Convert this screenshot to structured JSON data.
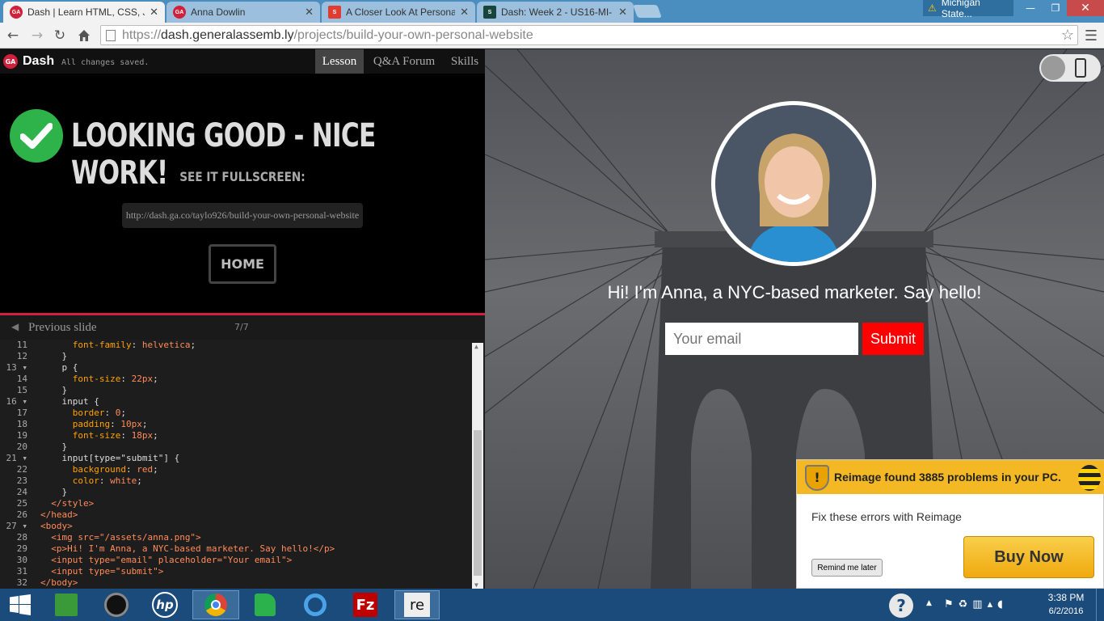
{
  "browser": {
    "tabs": [
      {
        "title": "Dash | Learn HTML, CSS, J",
        "fav_color": "#d0203b",
        "fav_text": "GA",
        "active": true
      },
      {
        "title": "Anna Dowlin",
        "fav_color": "#d0203b",
        "fav_text": "GA",
        "active": false
      },
      {
        "title": "A Closer Look At Personal",
        "fav_color": "#e03c31",
        "fav_text": "S",
        "active": false
      },
      {
        "title": "Dash: Week 2 - US16-MI-",
        "fav_color": "#18453b",
        "fav_text": "S",
        "active": false
      }
    ],
    "profile_label": "Michigan State...",
    "url_scheme": "https://",
    "url_host": "dash.generalassemb.ly",
    "url_path": "/projects/build-your-own-personal-website"
  },
  "app": {
    "brand": "Dash",
    "brand_badge": "GA",
    "status": "All changes saved.",
    "nav": [
      "Lesson",
      "Q&A Forum",
      "Skills"
    ],
    "headline": "LOOKING GOOD - NICE WORK!",
    "subhead": "SEE IT FULLSCREEN:",
    "fullscreen_url": "http://dash.ga.co/taylo926/build-your-own-personal-website",
    "home_label": "HOME",
    "prev_label": "Previous slide",
    "slide_counter": "7/7"
  },
  "editor": {
    "lines": [
      {
        "n": "11",
        "fold": false,
        "indent": "      ",
        "html": "font-family: helvetica;"
      },
      {
        "n": "12",
        "fold": false,
        "indent": "    ",
        "html": "}"
      },
      {
        "n": "13",
        "fold": true,
        "indent": "    ",
        "html": "p {"
      },
      {
        "n": "14",
        "fold": false,
        "indent": "      ",
        "html": "font-size: 22px;"
      },
      {
        "n": "15",
        "fold": false,
        "indent": "    ",
        "html": "}"
      },
      {
        "n": "16",
        "fold": true,
        "indent": "    ",
        "html": "input {"
      },
      {
        "n": "17",
        "fold": false,
        "indent": "      ",
        "html": "border: 0;"
      },
      {
        "n": "18",
        "fold": false,
        "indent": "      ",
        "html": "padding: 10px;"
      },
      {
        "n": "19",
        "fold": false,
        "indent": "      ",
        "html": "font-size: 18px;"
      },
      {
        "n": "20",
        "fold": false,
        "indent": "    ",
        "html": "}"
      },
      {
        "n": "21",
        "fold": true,
        "indent": "    ",
        "html": "input[type=\"submit\"] {"
      },
      {
        "n": "22",
        "fold": false,
        "indent": "      ",
        "html": "background: red;"
      },
      {
        "n": "23",
        "fold": false,
        "indent": "      ",
        "html": "color: white;"
      },
      {
        "n": "24",
        "fold": false,
        "indent": "    ",
        "html": "}"
      },
      {
        "n": "25",
        "fold": false,
        "indent": "  ",
        "html": "</style>"
      },
      {
        "n": "26",
        "fold": false,
        "indent": "",
        "html": "</head>"
      },
      {
        "n": "27",
        "fold": true,
        "indent": "",
        "html": "<body>"
      },
      {
        "n": "28",
        "fold": false,
        "indent": "  ",
        "html": "<img src=\"/assets/anna.png\">"
      },
      {
        "n": "29",
        "fold": false,
        "indent": "  ",
        "html": "<p>Hi! I'm Anna, a NYC-based marketer. Say hello!</p>"
      },
      {
        "n": "30",
        "fold": false,
        "indent": "  ",
        "html": "<input type=\"email\" placeholder=\"Your email\">"
      },
      {
        "n": "31",
        "fold": false,
        "indent": "  ",
        "html": "<input type=\"submit\">"
      },
      {
        "n": "32",
        "fold": false,
        "indent": "",
        "html": "</body>"
      }
    ]
  },
  "preview": {
    "tagline": "Hi! I'm Anna, a NYC-based marketer. Say hello!",
    "email_placeholder": "Your email",
    "submit_label": "Submit"
  },
  "popup": {
    "title": "Reimage found 3885 problems in your PC.",
    "body": "Fix these errors with Reimage",
    "remind_label": "Remind me later",
    "buy_label": "Buy Now"
  },
  "taskbar": {
    "time": "3:38 PM",
    "date": "6/2/2016"
  },
  "colors": {
    "accent_red": "#d0203b",
    "check_green": "#2db34a",
    "submit_red": "#ff0000",
    "buy_gold": "#f3b823"
  }
}
